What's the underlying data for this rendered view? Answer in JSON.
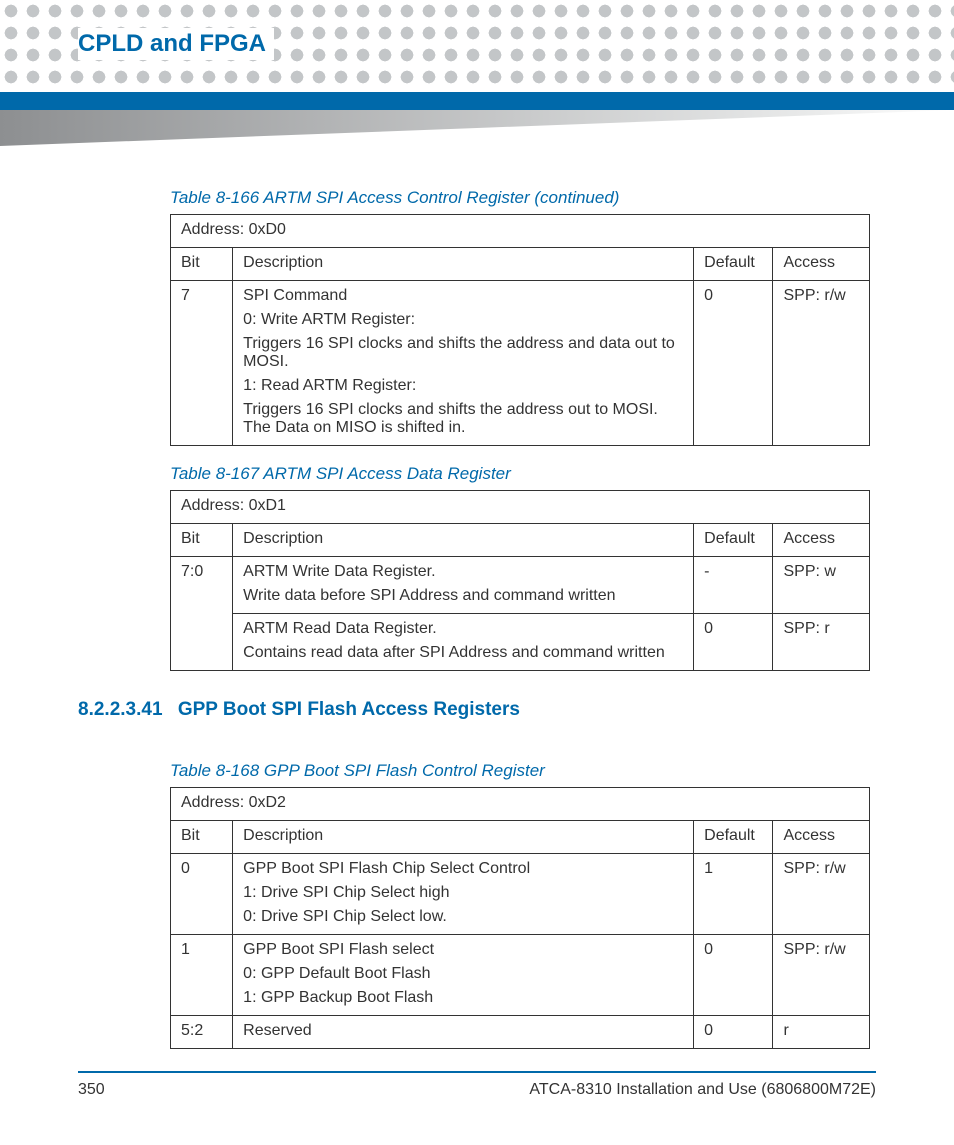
{
  "chapter_title": "CPLD and FPGA",
  "table166": {
    "caption": "Table 8-166 ARTM SPI Access Control Register (continued)",
    "address": "Address: 0xD0",
    "head": {
      "bit": "Bit",
      "desc": "Description",
      "def": "Default",
      "acc": "Access"
    },
    "rows": [
      {
        "bit": "7",
        "desc": [
          "SPI Command",
          "0: Write ARTM Register:",
          "Triggers 16 SPI clocks and shifts the address and data out to MOSI.",
          "1: Read ARTM Register:",
          "Triggers 16 SPI clocks and shifts the address out to MOSI. The Data on MISO is shifted in."
        ],
        "def": "0",
        "acc": "SPP: r/w"
      }
    ]
  },
  "table167": {
    "caption": "Table 8-167 ARTM SPI Access Data Register",
    "address": "Address: 0xD1",
    "head": {
      "bit": "Bit",
      "desc": "Description",
      "def": "Default",
      "acc": "Access"
    },
    "rows": [
      {
        "bit": "7:0",
        "desc": [
          "ARTM Write Data Register.",
          "Write data before SPI Address and command written"
        ],
        "def": "-",
        "acc": "SPP: w"
      },
      {
        "bit": "",
        "desc": [
          "ARTM Read Data Register.",
          "Contains read data after SPI Address and command written"
        ],
        "def": "0",
        "acc": "SPP: r"
      }
    ]
  },
  "section": {
    "number": "8.2.2.3.41",
    "title": "GPP Boot SPI Flash Access Registers"
  },
  "table168": {
    "caption": "Table 8-168 GPP Boot SPI Flash Control Register",
    "address": "Address: 0xD2",
    "head": {
      "bit": "Bit",
      "desc": "Description",
      "def": "Default",
      "acc": "Access"
    },
    "rows": [
      {
        "bit": "0",
        "desc": [
          "GPP Boot SPI Flash Chip Select Control",
          "1: Drive SPI Chip Select high",
          "0: Drive SPI Chip Select low."
        ],
        "def": "1",
        "acc": "SPP: r/w"
      },
      {
        "bit": "1",
        "desc": [
          "GPP Boot SPI Flash select",
          "0: GPP Default Boot Flash",
          "1: GPP Backup Boot Flash"
        ],
        "def": "0",
        "acc": "SPP: r/w"
      },
      {
        "bit": "5:2",
        "desc": [
          "Reserved"
        ],
        "def": "0",
        "acc": "r"
      }
    ]
  },
  "footer": {
    "page": "350",
    "doc": "ATCA-8310 Installation and Use (6806800M72E)"
  }
}
